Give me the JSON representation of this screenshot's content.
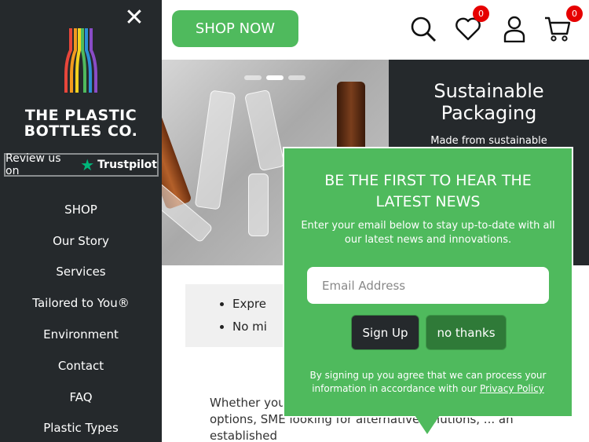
{
  "sidebar": {
    "close_label": "✕",
    "brand_line1": "THE PLASTIC",
    "brand_line2": "BOTTLES CO.",
    "trustpilot_prefix": "Review us on",
    "trustpilot_name": "Trustpilot",
    "nav": [
      {
        "label": "SHOP"
      },
      {
        "label": "Our Story"
      },
      {
        "label": "Services"
      },
      {
        "label": "Tailored to You®"
      },
      {
        "label": "Environment"
      },
      {
        "label": "Contact"
      },
      {
        "label": "FAQ"
      },
      {
        "label": "Plastic Types"
      }
    ]
  },
  "header": {
    "shop_now": "SHOP NOW",
    "wishlist_count": "0",
    "cart_count": "0",
    "icons": [
      "search-icon",
      "heart-icon",
      "user-icon",
      "cart-icon"
    ]
  },
  "hero": {
    "title_line1": "Sustainable",
    "title_line2": "Packaging",
    "subtitle": "Made from sustainable"
  },
  "features": {
    "items": [
      "Expre",
      "No mi"
    ]
  },
  "body": {
    "text": "Whether you ... development, a start-up exploring ... options, SME looking for alternative solutions, ... an established"
  },
  "popup": {
    "title_line1": "BE THE FIRST TO HEAR THE",
    "title_line2": "LATEST NEWS",
    "description": "Enter your email below to stay up-to-date with all our latest news and innovations.",
    "email_placeholder": "Email Address",
    "signup_label": "Sign Up",
    "nothanks_label": "no thanks",
    "legal_text": "By signing up you agree that we can process your information in accordance with our",
    "privacy_link": "Privacy Policy"
  },
  "colors": {
    "brand_green": "#4fba5d",
    "dark": "#25292c",
    "badge_red": "#e60000",
    "trustpilot_green": "#00b67a"
  }
}
